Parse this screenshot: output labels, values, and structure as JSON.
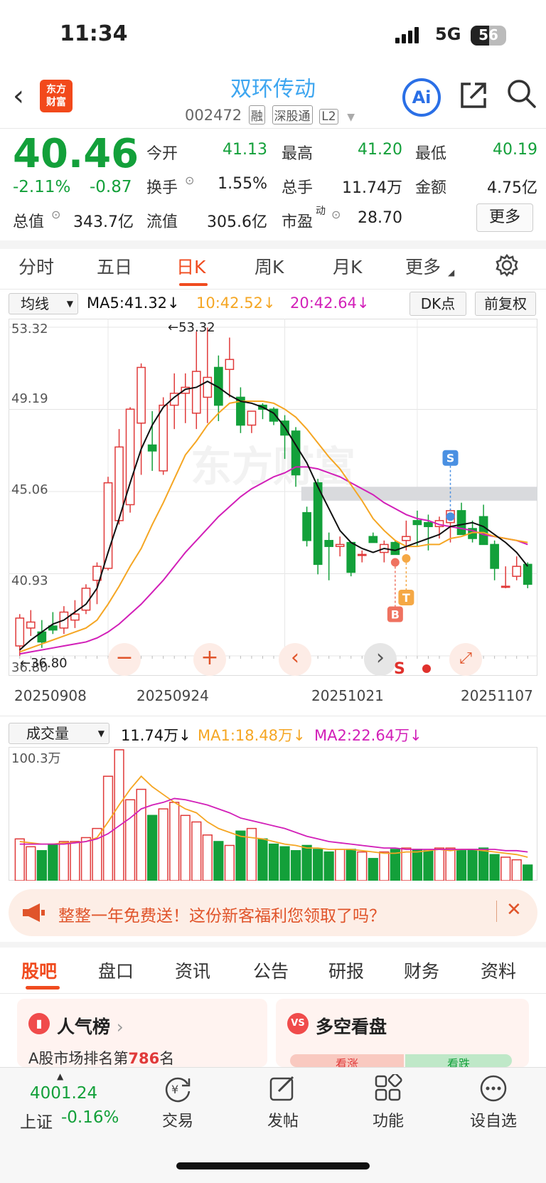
{
  "status": {
    "time": "11:34",
    "network": "5G",
    "battery": "56",
    "battery_level": 0.56
  },
  "header": {
    "title": "双环传动",
    "code": "002472",
    "tags": [
      "融",
      "深股通",
      "L2"
    ],
    "ai": "Ai"
  },
  "quote": {
    "price": "40.46",
    "change_pct": "-2.11%",
    "change": "-0.87",
    "rows": [
      [
        [
          "今开",
          "41.13"
        ],
        [
          "最高",
          "41.20"
        ],
        [
          "最低",
          "40.19"
        ]
      ],
      [
        [
          "换手",
          "1.55%"
        ],
        [
          "总手",
          "11.74万"
        ],
        [
          "金额",
          "4.75亿"
        ]
      ],
      [
        [
          "总值",
          "343.7亿"
        ],
        [
          "流值",
          "305.6亿"
        ],
        [
          "市盈",
          "28.70"
        ]
      ]
    ],
    "pe_sup": "动",
    "more": "更多"
  },
  "kline_tabs": [
    "分时",
    "五日",
    "日K",
    "周K",
    "月K",
    "更多"
  ],
  "kline_active": "日K",
  "ma_bar": {
    "select": "均线",
    "ma5": "MA5:41.32",
    "ma10": "10:42.52",
    "ma20": "20:42.64",
    "dk": "DK点",
    "fq": "前复权"
  },
  "price_axis": [
    "53.32",
    "49.19",
    "45.06",
    "40.93",
    "36.80"
  ],
  "annotations": {
    "high": "53.32",
    "low": "36.80",
    "buy": "B",
    "t": "T",
    "sell": "S",
    "s_text": "S"
  },
  "dates": [
    "20250908",
    "20250924",
    "20251021",
    "20251107"
  ],
  "watermark": "东方财富",
  "vol_bar": {
    "select": "成交量",
    "vol": "11.74万",
    "ma1": "MA1:18.48万",
    "ma2": "MA2:22.64万",
    "axis_top": "100.3万"
  },
  "colors": {
    "up": "#e03a3a",
    "down": "#13a03a",
    "ma5": "#111111",
    "ma10": "#f5a623",
    "ma20": "#d21fb8",
    "accent": "#f04b1f"
  },
  "chart_data": {
    "type": "candlestick",
    "price_range": [
      36.8,
      53.32
    ],
    "vol_max": 100.3,
    "candles": [
      [
        37.3,
        38.9,
        36.8,
        38.7
      ],
      [
        38.2,
        39.1,
        37.8,
        38.5
      ],
      [
        38.0,
        38.6,
        37.2,
        37.5
      ],
      [
        38.3,
        39.0,
        37.9,
        38.1
      ],
      [
        38.2,
        39.3,
        37.9,
        39.0
      ],
      [
        38.6,
        39.6,
        38.2,
        38.9
      ],
      [
        39.1,
        40.4,
        38.9,
        40.2
      ],
      [
        40.6,
        41.5,
        39.4,
        41.3
      ],
      [
        41.2,
        45.8,
        41.1,
        45.5
      ],
      [
        43.6,
        48.2,
        43.4,
        47.3
      ],
      [
        44.4,
        49.3,
        44.0,
        49.2
      ],
      [
        48.5,
        51.5,
        45.9,
        51.3
      ],
      [
        47.4,
        49.1,
        46.1,
        47.1
      ],
      [
        46.1,
        49.8,
        45.9,
        49.4
      ],
      [
        49.4,
        51.0,
        48.2,
        50.0
      ],
      [
        50.0,
        51.0,
        48.5,
        50.3
      ],
      [
        49.0,
        53.1,
        48.2,
        51.1
      ],
      [
        49.8,
        53.3,
        48.5,
        50.8
      ],
      [
        51.3,
        51.9,
        48.6,
        49.4
      ],
      [
        51.2,
        52.8,
        49.8,
        51.7
      ],
      [
        49.8,
        50.3,
        48.0,
        48.4
      ],
      [
        48.4,
        49.1,
        48.0,
        49.1
      ],
      [
        49.4,
        49.5,
        48.7,
        49.2
      ],
      [
        49.2,
        49.3,
        48.4,
        48.6
      ],
      [
        48.6,
        48.9,
        46.7,
        47.9
      ],
      [
        48.1,
        48.3,
        45.3,
        45.9
      ],
      [
        44.0,
        44.3,
        42.3,
        42.6
      ],
      [
        45.5,
        45.7,
        40.9,
        41.4
      ],
      [
        42.6,
        43.0,
        40.6,
        42.3
      ],
      [
        42.3,
        42.8,
        41.8,
        42.4
      ],
      [
        42.5,
        42.5,
        40.8,
        41.0
      ],
      [
        41.9,
        42.1,
        41.5,
        41.9
      ],
      [
        42.8,
        43.0,
        42.5,
        42.5
      ],
      [
        42.0,
        42.6,
        41.5,
        42.4
      ],
      [
        42.5,
        42.6,
        41.9,
        41.9
      ],
      [
        42.6,
        43.6,
        42.1,
        42.8
      ],
      [
        43.6,
        44.1,
        42.3,
        43.4
      ],
      [
        43.5,
        43.9,
        42.1,
        43.3
      ],
      [
        43.3,
        43.8,
        42.7,
        43.6
      ],
      [
        43.5,
        44.2,
        42.5,
        44.1
      ],
      [
        44.1,
        44.5,
        42.9,
        42.9
      ],
      [
        43.2,
        43.6,
        42.5,
        42.7
      ],
      [
        43.8,
        44.4,
        42.4,
        42.4
      ],
      [
        42.4,
        42.6,
        40.6,
        41.2
      ],
      [
        40.3,
        41.3,
        40.2,
        40.3
      ],
      [
        40.8,
        41.8,
        40.6,
        41.3
      ],
      [
        41.4,
        41.5,
        40.2,
        40.4
      ]
    ],
    "ma5": [
      37.1,
      37.6,
      38.0,
      38.4,
      38.6,
      39.0,
      39.4,
      40.2,
      42.0,
      43.7,
      45.5,
      47.2,
      48.4,
      49.3,
      49.8,
      50.2,
      50.3,
      50.6,
      50.3,
      49.9,
      49.6,
      49.5,
      49.3,
      49.0,
      48.3,
      47.4,
      46.5,
      45.3,
      44.2,
      43.1,
      42.5,
      42.2,
      42.0,
      42.2,
      42.1,
      42.3,
      42.5,
      42.7,
      42.9,
      43.3,
      43.4,
      43.5,
      43.3,
      42.9,
      42.5,
      42.0,
      41.3
    ],
    "ma10": [
      37.0,
      37.2,
      37.4,
      37.6,
      37.8,
      38.0,
      38.2,
      38.6,
      39.4,
      40.3,
      41.3,
      42.2,
      43.4,
      44.5,
      45.7,
      46.9,
      47.6,
      48.4,
      49.0,
      49.5,
      49.6,
      49.6,
      49.6,
      49.5,
      49.2,
      48.8,
      48.2,
      47.5,
      46.8,
      46.2,
      45.4,
      44.6,
      43.7,
      43.1,
      42.6,
      42.3,
      42.3,
      42.4,
      42.4,
      42.7,
      42.8,
      43.0,
      43.0,
      42.8,
      42.7,
      42.6,
      42.5
    ],
    "ma20": [
      36.9,
      37.0,
      37.1,
      37.2,
      37.3,
      37.4,
      37.5,
      37.7,
      38.0,
      38.4,
      38.9,
      39.4,
      40.0,
      40.6,
      41.3,
      42.0,
      42.6,
      43.2,
      43.8,
      44.3,
      44.8,
      45.2,
      45.5,
      45.8,
      46.0,
      46.3,
      46.3,
      46.2,
      46.0,
      45.8,
      45.5,
      45.2,
      44.9,
      44.5,
      44.2,
      43.9,
      43.7,
      43.6,
      43.4,
      43.3,
      43.2,
      43.1,
      42.9,
      42.8,
      42.7,
      42.6,
      42.4
    ],
    "volume": [
      32,
      26,
      23,
      28,
      30,
      30,
      33,
      40,
      80,
      100.3,
      62,
      70,
      50,
      55,
      60,
      50,
      45,
      35,
      30,
      27,
      38,
      40,
      32,
      28,
      26,
      23,
      27,
      24,
      22,
      24,
      24,
      22,
      17,
      22,
      24,
      25,
      24,
      23,
      25,
      25,
      23,
      24,
      25,
      20,
      18,
      16,
      12
    ],
    "vol_ma1": [
      30,
      29,
      28,
      28,
      29,
      29,
      30,
      33,
      45,
      58,
      70,
      80,
      72,
      66,
      60,
      55,
      52,
      45,
      40,
      37,
      34,
      33,
      32,
      30,
      28,
      27,
      25,
      25,
      24,
      24,
      24,
      23,
      22,
      21,
      21,
      22,
      22,
      23,
      24,
      23,
      24,
      24,
      23,
      22,
      21,
      20,
      18
    ],
    "vol_ma2": [
      28,
      28,
      28,
      28,
      28,
      29,
      30,
      32,
      36,
      42,
      48,
      55,
      58,
      60,
      63,
      62,
      60,
      58,
      55,
      52,
      48,
      46,
      44,
      42,
      40,
      37,
      34,
      32,
      30,
      29,
      28,
      27,
      26,
      25,
      25,
      24,
      24,
      24,
      24,
      24,
      24,
      24,
      24,
      24,
      23,
      23,
      22
    ],
    "resistance_band": [
      44.6,
      45.3
    ]
  },
  "promo": {
    "text": "整整一年免费送！这份新客福利您领取了吗？"
  },
  "bottom_tabs": [
    "股吧",
    "盘口",
    "资讯",
    "公告",
    "研报",
    "财务",
    "资料"
  ],
  "cards": {
    "rank_title": "人气榜",
    "rank_prefix": "A股市场排名第",
    "rank_no": "786",
    "rank_suffix": "名",
    "ls_title": "多空看盘",
    "ls_up": "看涨",
    "ls_down": "看跌"
  },
  "nav": {
    "index_value": "4001.24",
    "index_name": "上证",
    "index_change": "-0.16%",
    "items": [
      "交易",
      "发帖",
      "功能",
      "设自选"
    ]
  }
}
